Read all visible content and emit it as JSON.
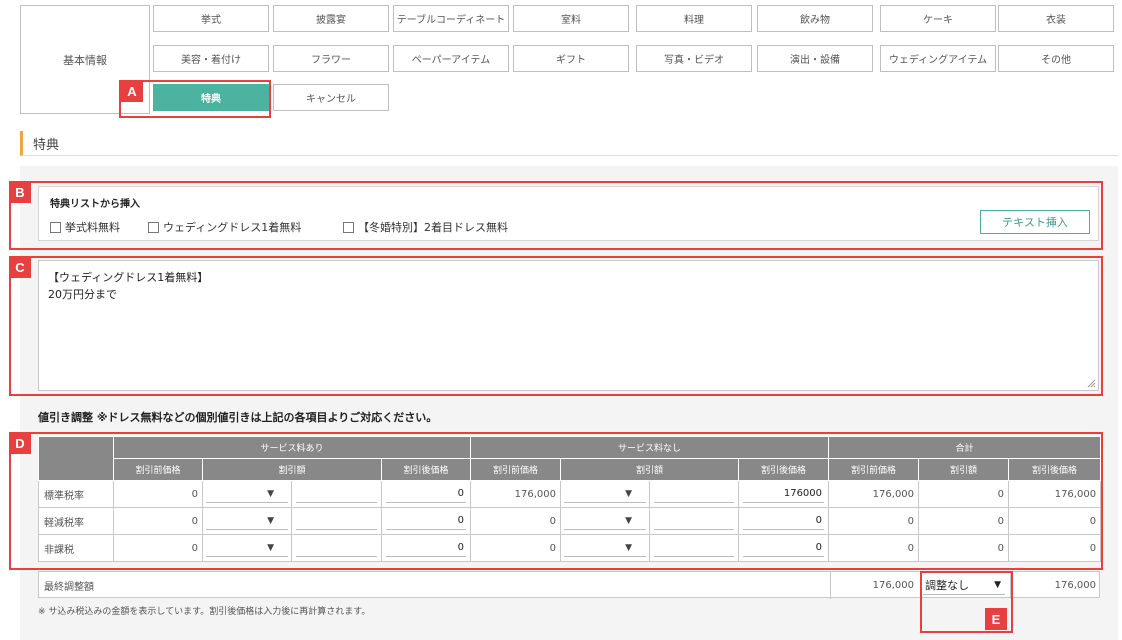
{
  "nav": {
    "basic_info": "基本情報",
    "row1": [
      "挙式",
      "披露宴",
      "テーブルコーディネート",
      "室料",
      "料理",
      "飲み物",
      "ケーキ",
      "衣装"
    ],
    "row2": [
      "美容・着付け",
      "フラワー",
      "ペーパーアイテム",
      "ギフト",
      "写真・ビデオ",
      "演出・設備",
      "ウェディングアイテム",
      "その他"
    ],
    "active": "特典",
    "cancel": "キャンセル"
  },
  "section_title": "特典",
  "callouts": [
    "A",
    "B",
    "C",
    "D",
    "E"
  ],
  "bonus_list": {
    "title": "特典リストから挿入",
    "items": [
      "挙式料無料",
      "ウェディングドレス1着無料",
      "【冬婚特別】2着目ドレス無料"
    ],
    "insert_button": "テキスト挿入"
  },
  "memo_text": "【ウェディングドレス1着無料】\n20万円分まで",
  "discount_heading": "値引き調整 ※ドレス無料などの個別値引きは上記の各項目よりご対応ください。",
  "table": {
    "group_headers": [
      "サービス料あり",
      "サービス料なし",
      "合計"
    ],
    "sub_headers": [
      "割引前価格",
      "割引額",
      "割引後価格",
      "割引前価格",
      "割引額",
      "割引後価格",
      "割引前価格",
      "割引額",
      "割引後価格"
    ],
    "rows": [
      {
        "label": "標準税率",
        "svc_pre": "0",
        "svc_post": "0",
        "nosvc_pre": "176,000",
        "nosvc_post": "176000",
        "tot_pre": "176,000",
        "tot_disc": "0",
        "tot_post": "176,000"
      },
      {
        "label": "軽減税率",
        "svc_pre": "0",
        "svc_post": "0",
        "nosvc_pre": "0",
        "nosvc_post": "0",
        "tot_pre": "0",
        "tot_disc": "0",
        "tot_post": "0"
      },
      {
        "label": "非課税",
        "svc_pre": "0",
        "svc_post": "0",
        "nosvc_pre": "0",
        "nosvc_post": "0",
        "tot_pre": "0",
        "tot_disc": "0",
        "tot_post": "0"
      }
    ],
    "dropdown_arrow": "▼"
  },
  "final_row": {
    "label": "最終調整額",
    "pre": "176,000",
    "select_value": "調整なし",
    "post": "176,000"
  },
  "footnote": "※ サ込み税込みの金額を表示しています。割引後価格は入力後に再計算されます。",
  "colors": {
    "accent": "#4db3a1",
    "callout": "#e84040",
    "header_bar": "#f0a83c",
    "table_header": "#888888"
  }
}
